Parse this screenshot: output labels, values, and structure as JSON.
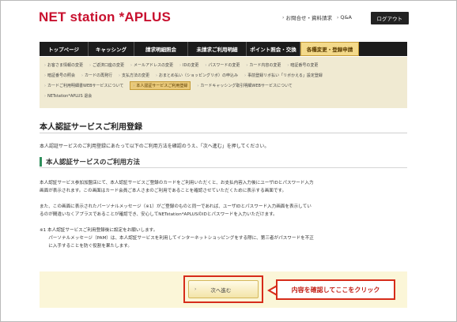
{
  "header": {
    "logo": "NET station *APLUS",
    "links": [
      {
        "label": "お問合せ・資料請求"
      },
      {
        "label": "Q&A"
      }
    ],
    "logout": "ログアウト"
  },
  "nav": {
    "items": [
      {
        "label": "トップページ",
        "w": 62
      },
      {
        "label": "キャッシング",
        "w": 58
      },
      {
        "label": "請求明細照会",
        "w": 68
      },
      {
        "label": "未請求ご利用明細",
        "w": 74
      },
      {
        "label": "ポイント照会・交換",
        "w": 68
      },
      {
        "label": "各種変更・登録申請",
        "w": 74,
        "active": true
      }
    ]
  },
  "subnav": {
    "rows": [
      [
        "お客さま情報の変更",
        "ご返済口座の変更",
        "メールアドレスの変更",
        "IDの変更",
        "パスワードの変更",
        "カード内容の変更",
        "暗証番号の変更"
      ],
      [
        "暗証番号の照会",
        "カードの再発行",
        "支払方法の変更",
        "おまとめ払い（ショッピングリボ）の申込み",
        "事前登録リボ払い「リボかえる」設定登録"
      ],
      [
        "カードご利用明細書WEBサービスについて",
        "本人認証サービスご利用登録",
        "カードキャッシング取引明細WEBサービスについて"
      ],
      [
        "NETstation*APLUS 退会"
      ]
    ],
    "active": "本人認証サービスご利用登録"
  },
  "main": {
    "title": "本人認証サービスご利用登録",
    "intro": "本人認証サービスのご利用登録にあたって以下のご利用方法を確認のうえ、「次へ進む」を押してください。",
    "section_title": "本人認証サービスのご利用方法",
    "paragraphs": [
      "本人認証サービス参加加盟店にて、本人認証サービスご登録のカードをご利用いただくと、お支払内容入力後にユーザIDとパスワード入力",
      "画面が表示されます。この画面はカード会員ご本人さまのご利用であることを確認させていただくために表示する画面です。",
      "また、この画面に表示されたパーソナルメッセージ（※1）がご登録のものと同一であれば、ユーザIDとパスワード入力画面を表示してい",
      "るのが間違いなくアプラスであることが確認でき、安心してNETstation*APLUSのIDとパスワードを入力いただけます。",
      "※1 本人認証サービスご利用登録後に設定をお願いします。",
      "　　パーソナルメッセージ（PAM）は、本人認証サービスを利用してインターネットショッピングをする際に、第三者がパスワードを不正",
      "　　に入手することを防ぐ役割を果たします。"
    ],
    "next_button": "次へ進む",
    "callout": "内容を確認してここをクリック"
  }
}
